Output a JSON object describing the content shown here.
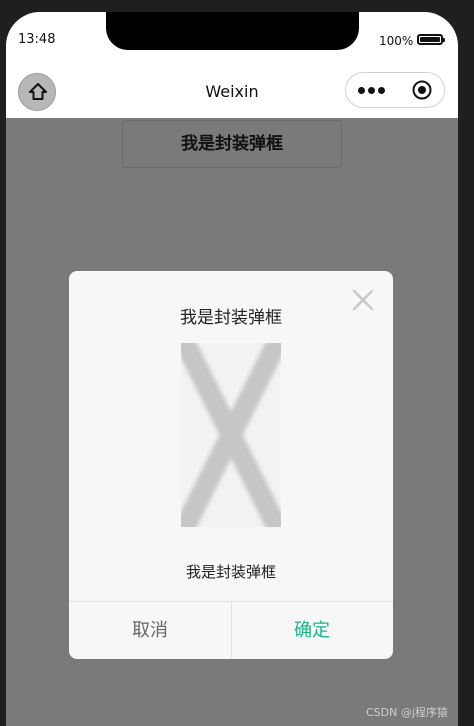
{
  "status_bar": {
    "time": "13:48",
    "battery_text": "100%"
  },
  "nav": {
    "title": "Weixin"
  },
  "page": {
    "title": "我是封装弹框"
  },
  "modal": {
    "title": "我是封装弹框",
    "text": "我是封装弹框",
    "cancel_label": "取消",
    "confirm_label": "确定",
    "confirm_color": "#18b38b"
  },
  "watermark": {
    "text": "CSDN @j程序猿"
  },
  "icons": {
    "home": "home-icon",
    "more": "more-dots-icon",
    "target": "target-icon",
    "close": "close-icon"
  }
}
